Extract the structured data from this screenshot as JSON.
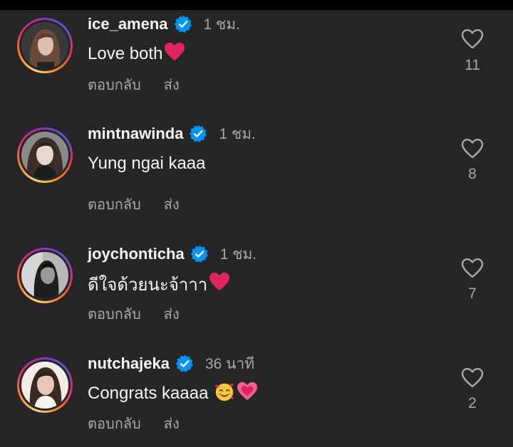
{
  "comments": [
    {
      "username": "ice_amena",
      "verified": true,
      "timestamp": "1 ชม.",
      "text": "Love both",
      "emoji": [
        "red-heart"
      ],
      "reply_label": "ตอบกลับ",
      "share_label": "ส่ง",
      "likes": "11"
    },
    {
      "username": "mintnawinda",
      "verified": true,
      "timestamp": "1 ชม.",
      "text": "Yung ngai kaaa",
      "emoji": [],
      "reply_label": "ตอบกลับ",
      "share_label": "ส่ง",
      "likes": "8"
    },
    {
      "username": "joychonticha",
      "verified": true,
      "timestamp": "1 ชม.",
      "text": "ดีใจด้วยนะจ้าาา",
      "emoji": [
        "red-heart"
      ],
      "reply_label": "ตอบกลับ",
      "share_label": "ส่ง",
      "likes": "7"
    },
    {
      "username": "nutchajeka",
      "verified": true,
      "timestamp": "36 นาที",
      "text": "Congrats kaaaa",
      "emoji": [
        "smiling-face-with-hearts",
        "growing-heart"
      ],
      "reply_label": "ตอบกลับ",
      "share_label": "ส่ง",
      "likes": "2"
    }
  ],
  "colors": {
    "background": "#262626",
    "status_bar": "#000000",
    "text_primary": "#f5f5f5",
    "text_secondary": "#a8a8a8",
    "verified_badge": "#0095f6",
    "emoji_heart": "#e0245e"
  }
}
